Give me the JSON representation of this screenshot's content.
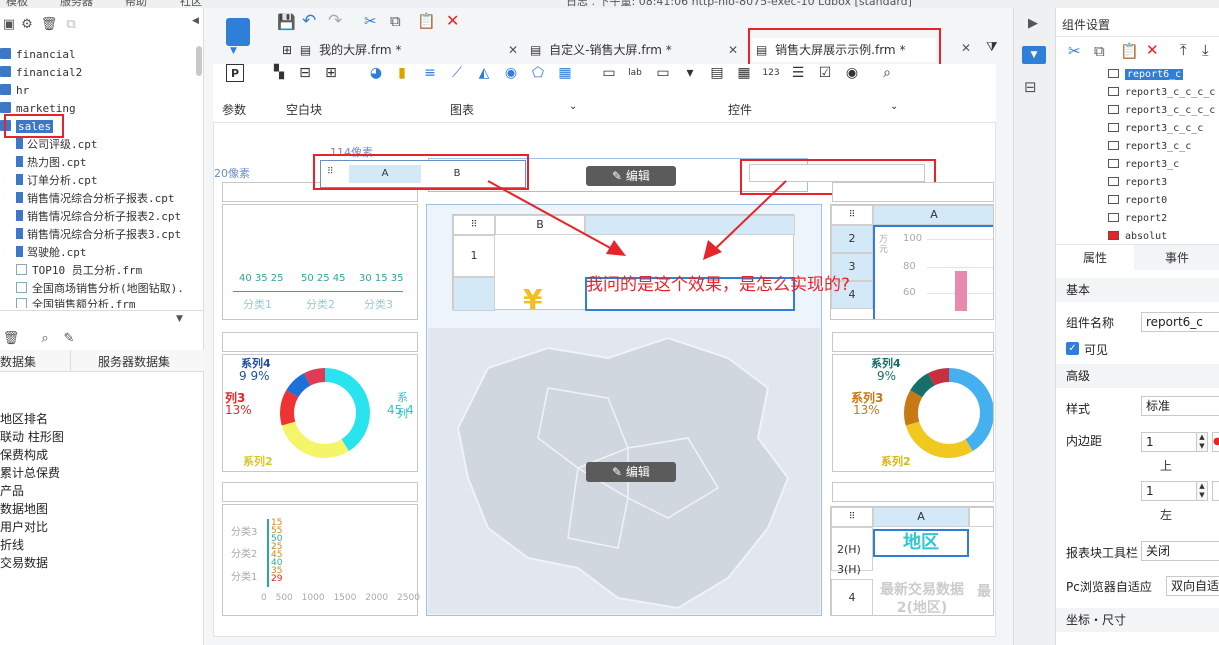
{
  "title_bar": {
    "left_menus": [
      "模板",
      "服务器",
      "帮助",
      "社区"
    ],
    "title": "日志 . 下午量: 08:41:06 http-nio-8075-exec-10 Ldbox [standard]"
  },
  "left_panel": {
    "tree": [
      {
        "label": "financial",
        "type": "folder"
      },
      {
        "label": "financial2",
        "type": "folder"
      },
      {
        "label": "hr",
        "type": "folder"
      },
      {
        "label": "marketing",
        "type": "folder"
      },
      {
        "label": "sales",
        "type": "folder",
        "selected": true
      },
      {
        "label": "公司评级.cpt",
        "type": "file"
      },
      {
        "label": "热力图.cpt",
        "type": "file"
      },
      {
        "label": "订单分析.cpt",
        "type": "file"
      },
      {
        "label": "销售情况综合分析子报表.cpt",
        "type": "file"
      },
      {
        "label": "销售情况综合分析子报表2.cpt",
        "type": "file"
      },
      {
        "label": "销售情况综合分析子报表3.cpt",
        "type": "file"
      },
      {
        "label": "驾驶舱.cpt",
        "type": "file"
      },
      {
        "label": "TOP10 员工分析.frm",
        "type": "form"
      },
      {
        "label": "全国商场销售分析(地图钻取).",
        "type": "form"
      },
      {
        "label": "全国销售额分析.frm",
        "type": "form"
      }
    ],
    "dataset_tabs": [
      "数据集",
      "服务器数据集"
    ],
    "datasets": [
      "地区排名",
      "联动 柱形图",
      "保费构成",
      "累计总保费",
      "产品",
      "数据地图",
      "用户对比",
      "折线",
      "交易数据"
    ]
  },
  "tabs": [
    {
      "label": "我的大屏.frm *"
    },
    {
      "label": "自定义-销售大屏.frm *"
    },
    {
      "label": "销售大屏展示示例.frm *",
      "active": true
    }
  ],
  "ribbon": {
    "groups": [
      "参数",
      "空白块",
      "图表",
      "控件"
    ]
  },
  "canvas": {
    "ruler_label_top": "114像素",
    "ruler_label_left": "20像素",
    "edit_label": "编辑",
    "tab_widget_cols": [
      "A",
      "B"
    ],
    "center_report_col": "B",
    "center_report_row": "1",
    "annotation": "我问的是这个效果，是怎么实现的?",
    "bar_chart": {
      "values_text": [
        "40 35 25",
        "50 25 45",
        "30 15 35"
      ],
      "categories": [
        "分类1",
        "分类2",
        "分类3"
      ]
    },
    "donut_left": {
      "labels": [
        "系列4",
        "9 9%",
        "列3",
        "13%",
        "系列",
        "45 4",
        "系列2"
      ]
    },
    "donut_right": {
      "labels": [
        "系列4",
        "9%",
        "系列3",
        "13%",
        "系列2"
      ]
    },
    "hbar_chart": {
      "categories": [
        "分类3",
        "分类2",
        "分类1"
      ],
      "ticks": [
        "0",
        "500",
        "1000",
        "1500",
        "2000",
        "2500"
      ],
      "values": [
        "15",
        "55",
        "50",
        "25",
        "45",
        "40",
        "35",
        "29"
      ]
    },
    "right_top_report": {
      "col": "A",
      "rows": [
        "2",
        "3",
        "4"
      ],
      "axis_label": "万元",
      "ticks": [
        "100",
        "80",
        "60"
      ]
    },
    "right_bottom_report": {
      "col": "A",
      "rows": [
        "2(H)",
        "3(H)",
        "4"
      ],
      "title": "地区",
      "cell_text": "最新交易数据2(地区)",
      "cell_text2": "最"
    }
  },
  "right_panel": {
    "title": "组件设置",
    "components": [
      "report6_c",
      "report3_c_c_c_c",
      "report3_c_c_c_c",
      "report3_c_c_c",
      "report3_c_c",
      "report3_c",
      "report3",
      "report0",
      "report2",
      "absolut"
    ],
    "prop_tabs": [
      "属性",
      "事件"
    ],
    "section_basic": "基本",
    "component_name_label": "组件名称",
    "component_name_value": "report6_c",
    "visible_label": "可见",
    "section_advanced": "高级",
    "style_label": "样式",
    "style_value": "标准",
    "padding_label": "内边距",
    "padding_top": "1",
    "padding_top_caption": "上",
    "padding_left": "1",
    "padding_left_caption": "左",
    "toolbar_label": "报表块工具栏",
    "toolbar_value": "关闭",
    "pc_adapt_label": "Pc浏览器自适应",
    "pc_adapt_value": "双向自适",
    "section_coord": "坐标・尺寸"
  }
}
